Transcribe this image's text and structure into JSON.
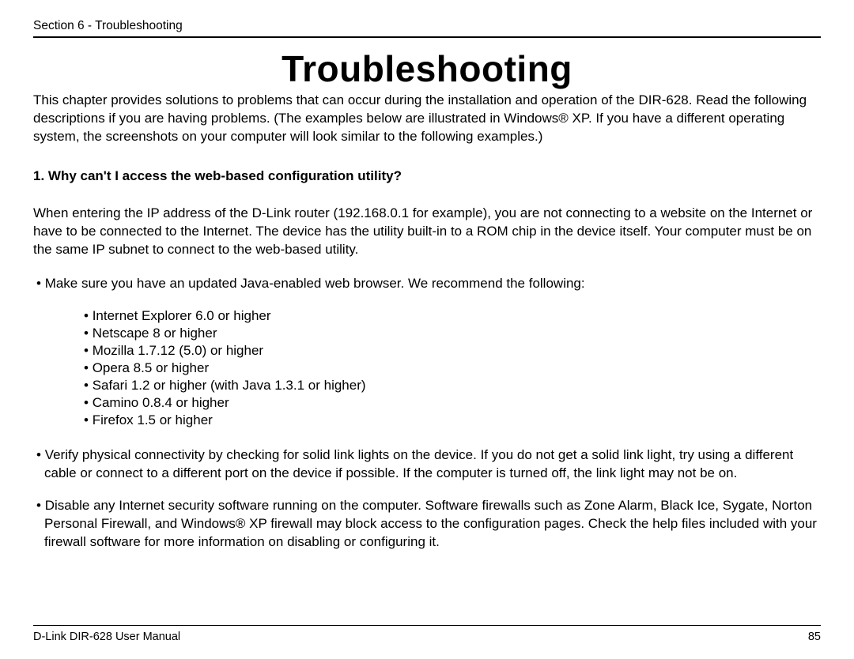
{
  "header": {
    "section_label": "Section 6 - Troubleshooting"
  },
  "page": {
    "title": "Troubleshooting",
    "intro": "This chapter provides solutions to problems that can occur during the installation and operation of the DIR-628.  Read the following descriptions if you are having problems.  (The examples below are illustrated in Windows® XP.  If you have a different operating system, the screenshots on your computer will look similar to the following examples.)",
    "question1": "1. Why can't I access the web-based configuration utility?",
    "answer1": "When entering the IP address of the D-Link router (192.168.0.1 for example), you are not connecting to a website on the Internet or have to be connected to the Internet. The device has the utility built-in to a ROM chip in the device itself. Your computer must be on the same IP subnet to connect to the web-based utility.",
    "bullets": {
      "b1": "Make sure you have an updated Java-enabled web browser. We recommend the following:",
      "sub": [
        "Internet Explorer 6.0 or higher",
        "Netscape 8 or higher",
        "Mozilla 1.7.12 (5.0) or higher",
        "Opera 8.5 or higher",
        "Safari 1.2 or higher (with Java 1.3.1 or higher)",
        "Camino 0.8.4 or higher",
        "Firefox 1.5 or higher"
      ],
      "b2": "Verify physical connectivity by checking for solid link lights on the device. If you do not get a solid link light, try using a different cable or connect to a different port on the device if possible. If the computer is turned off, the link light may not be on.",
      "b3": "Disable any Internet security software running on the computer. Software firewalls such as Zone Alarm, Black Ice, Sygate, Norton Personal Firewall, and Windows® XP firewall may block access to the configuration pages. Check the help files included with your firewall software for more information on disabling or configuring it."
    }
  },
  "footer": {
    "left": "D-Link DIR-628 User Manual",
    "right": "85"
  }
}
